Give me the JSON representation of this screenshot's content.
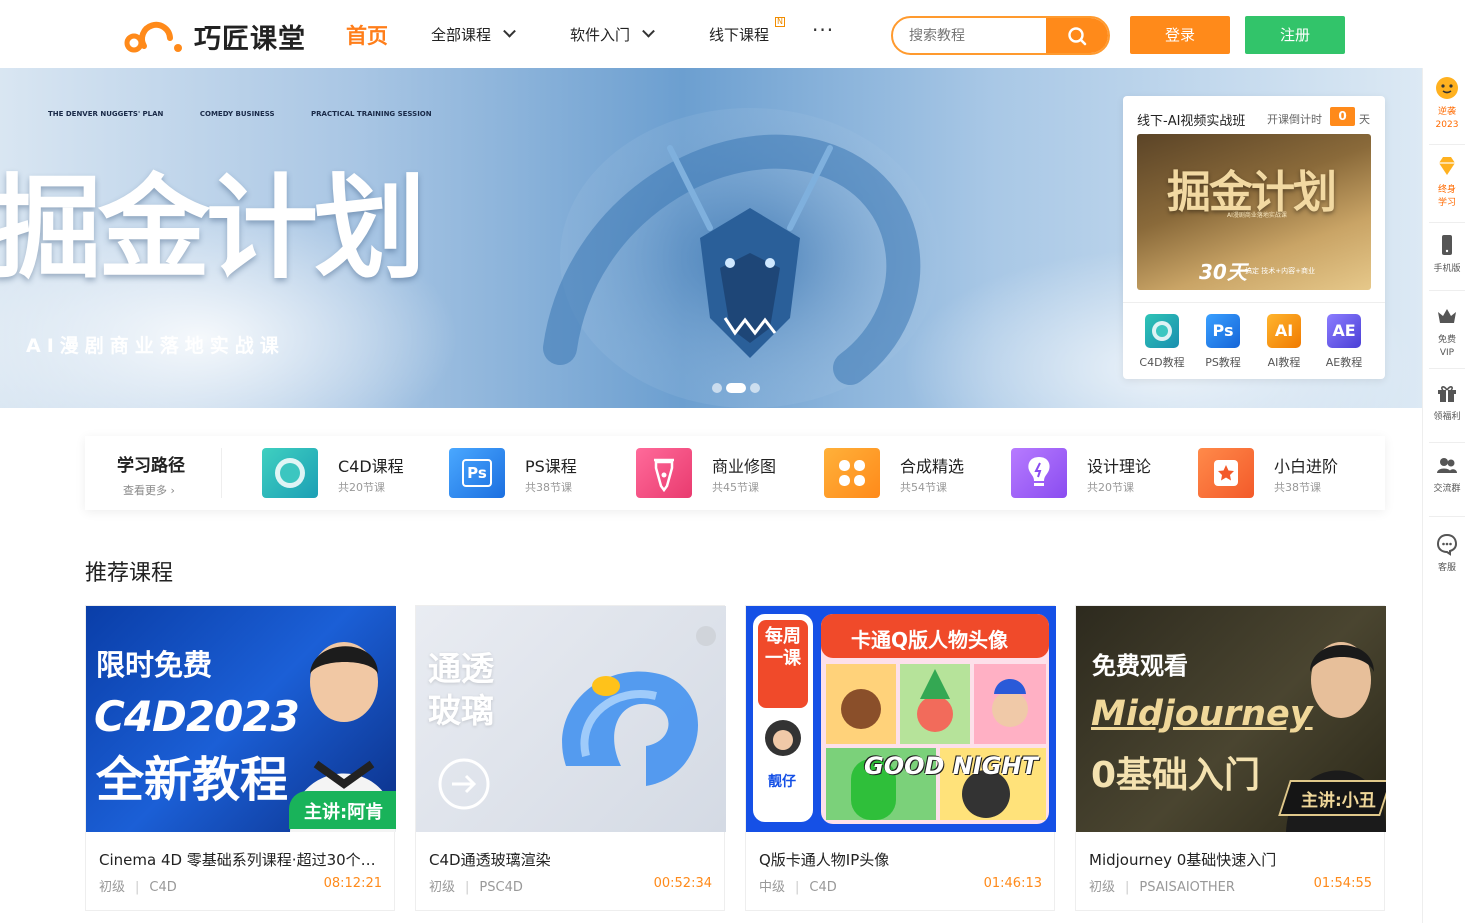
{
  "header": {
    "logo_text": "巧匠课堂",
    "nav_home": "首页",
    "nav_all_courses": "全部课程",
    "nav_software": "软件入门",
    "nav_offline": "线下课程",
    "nav_offline_badge": "N",
    "nav_more": "···",
    "search_placeholder": "搜索教程",
    "login": "登录",
    "register": "注册",
    "brand_color": "#ff8a1a",
    "register_color": "#32c46a"
  },
  "banner": {
    "title": "掘金计划",
    "subtitle": "AI漫剧商业落地实战课",
    "tags": [
      "THE DENVER NUGGETS' PLAN",
      "COMEDY BUSINESS",
      "PRACTICAL TRAINING SESSION"
    ],
    "slide_count": 3,
    "active_slide": 1
  },
  "promo": {
    "title": "线下-AI视频实战班",
    "countdown_label": "开课倒计时",
    "countdown_value": "0",
    "countdown_unit": "天",
    "image_title": "掘金计划",
    "image_sub": "AI漫剧商业落地实战课",
    "image_days": "30天",
    "image_tagline": "搞定 技术+内容+商业",
    "tools": [
      {
        "label": "C4D教程",
        "icon": "c4d-icon"
      },
      {
        "label": "PS教程",
        "icon": "ps-icon",
        "glyph": "Ps"
      },
      {
        "label": "AI教程",
        "icon": "ai-icon",
        "glyph": "AI"
      },
      {
        "label": "AE教程",
        "icon": "ae-icon",
        "glyph": "AE"
      }
    ]
  },
  "sidebar": {
    "items": [
      {
        "label": "逆袭",
        "label2": "2023",
        "icon": "emoji-icon"
      },
      {
        "label": "终身",
        "label2": "学习",
        "icon": "diamond-icon"
      },
      {
        "label": "手机版",
        "label2": "",
        "icon": "phone-icon"
      },
      {
        "label": "免费",
        "label2": "VIP",
        "icon": "crown-icon"
      },
      {
        "label": "领福利",
        "label2": "",
        "icon": "gift-icon"
      },
      {
        "label": "交流群",
        "label2": "",
        "icon": "group-icon"
      },
      {
        "label": "客服",
        "label2": "",
        "icon": "support-icon"
      }
    ]
  },
  "learning_path": {
    "title": "学习路径",
    "more": "查看更多",
    "items": [
      {
        "name": "C4D课程",
        "count": "共20节课",
        "icon": "c4d-path-icon"
      },
      {
        "name": "PS课程",
        "count": "共38节课",
        "icon": "ps-path-icon",
        "glyph": "Ps"
      },
      {
        "name": "商业修图",
        "count": "共45节课",
        "icon": "pen-icon"
      },
      {
        "name": "合成精选",
        "count": "共54节课",
        "icon": "grid-icon"
      },
      {
        "name": "设计理论",
        "count": "共20节课",
        "icon": "bulb-icon"
      },
      {
        "name": "小白进阶",
        "count": "共38节课",
        "icon": "star-icon"
      }
    ]
  },
  "recommended": {
    "title": "推荐课程",
    "courses": [
      {
        "name": "Cinema 4D 零基础系列课程·超过30个…",
        "level": "初级",
        "category": "C4D",
        "duration": "08:12:21",
        "thumb_line1": "限时免费",
        "thumb_line2": "C4D2023",
        "thumb_line3": "全新教程",
        "thumb_badge": "主讲:阿肯"
      },
      {
        "name": "C4D通透玻璃渲染",
        "level": "初级",
        "category": "PSC4D",
        "duration": "00:52:34",
        "thumb_line1": "通透",
        "thumb_line2": "玻璃"
      },
      {
        "name": "Q版卡通人物IP头像",
        "level": "中级",
        "category": "C4D",
        "duration": "01:46:13",
        "thumb_side": "每周一课",
        "thumb_teacher": "靓仔",
        "thumb_banner": "卡通Q版人物头像",
        "thumb_caption": "GOOD NIGHT"
      },
      {
        "name": "Midjourney 0基础快速入门",
        "level": "初级",
        "category": "PSAISAIOTHER",
        "duration": "01:54:55",
        "thumb_line1": "免费观看",
        "thumb_line2": "Midjourney",
        "thumb_line3": "0基础入门",
        "thumb_badge": "主讲:小丑"
      }
    ]
  }
}
